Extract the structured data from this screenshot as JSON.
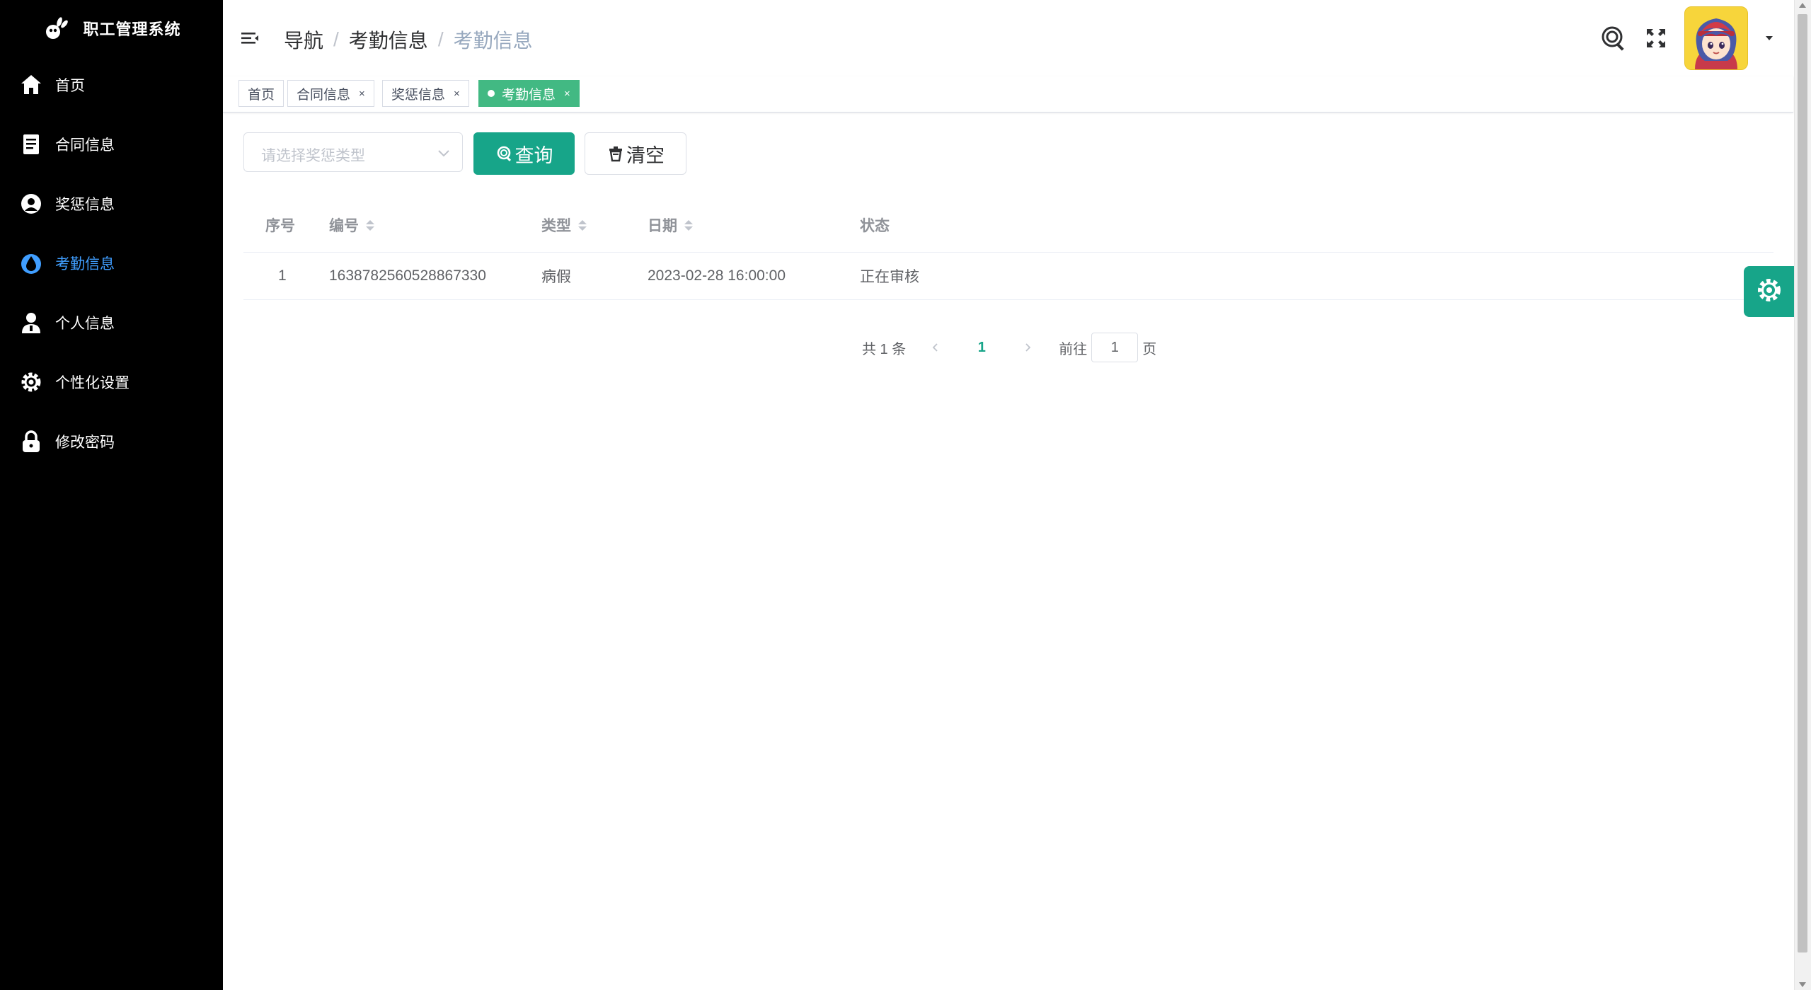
{
  "app": {
    "title": "职工管理系统"
  },
  "sidebar": {
    "items": [
      {
        "label": "首页",
        "icon": "home-icon",
        "active": false
      },
      {
        "label": "合同信息",
        "icon": "document-icon",
        "active": false
      },
      {
        "label": "奖惩信息",
        "icon": "award-icon",
        "active": false
      },
      {
        "label": "考勤信息",
        "icon": "drop-icon",
        "active": true
      },
      {
        "label": "个人信息",
        "icon": "user-icon",
        "active": false
      },
      {
        "label": "个性化设置",
        "icon": "gear-icon",
        "active": false
      },
      {
        "label": "修改密码",
        "icon": "lock-icon",
        "active": false
      }
    ]
  },
  "header": {
    "breadcrumb": [
      "导航",
      "考勤信息",
      "考勤信息"
    ],
    "separator": "/"
  },
  "tags": [
    {
      "label": "首页",
      "closable": false,
      "active": false
    },
    {
      "label": "合同信息",
      "closable": true,
      "active": false
    },
    {
      "label": "奖惩信息",
      "closable": true,
      "active": false
    },
    {
      "label": "考勤信息",
      "closable": true,
      "active": true
    }
  ],
  "tag_close_glyph": "×",
  "search": {
    "select_placeholder": "请选择奖惩类型",
    "query_label": "查询",
    "clear_label": "清空"
  },
  "table": {
    "columns": [
      "序号",
      "编号",
      "类型",
      "日期",
      "状态"
    ],
    "rows": [
      [
        "1",
        "1638782560528867330",
        "病假",
        "2023-02-28 16:00:00",
        "正在审核"
      ]
    ]
  },
  "pagination": {
    "total_text": "共 1 条",
    "current_page": "1",
    "goto_prefix": "前往",
    "goto_value": "1",
    "goto_suffix": "页"
  },
  "colors": {
    "primary": "#17a589",
    "sidebar_bg": "#000000",
    "active_menu": "#409eff",
    "tag_active": "#42b983"
  }
}
